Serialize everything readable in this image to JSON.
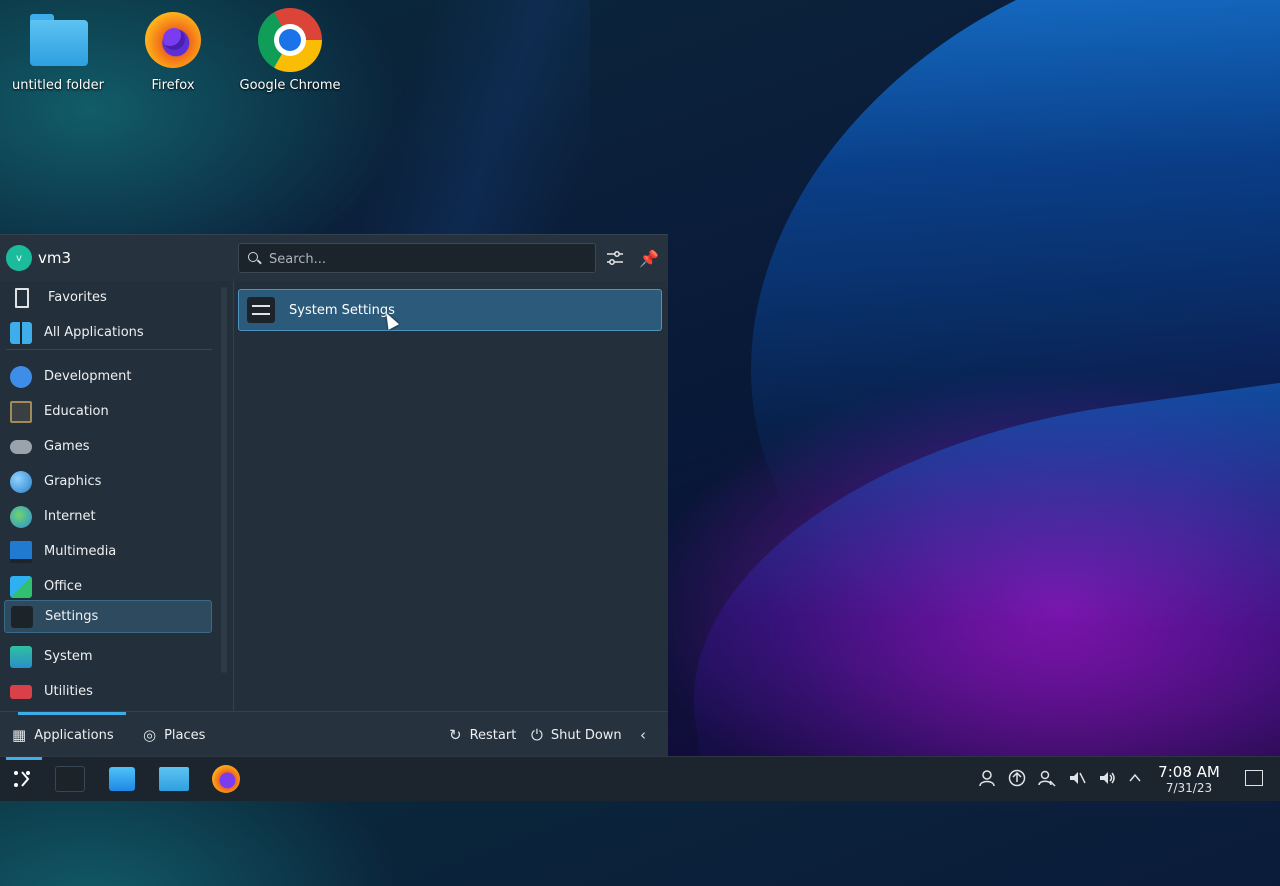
{
  "desktop": {
    "icons": [
      {
        "label": "untitled folder",
        "icon": "folder-icon"
      },
      {
        "label": "Firefox",
        "icon": "firefox-icon"
      },
      {
        "label": "Google Chrome",
        "icon": "chrome-icon"
      }
    ]
  },
  "launcher": {
    "user": {
      "initial": "v",
      "name": "vm3"
    },
    "search": {
      "placeholder": "Search...",
      "value": ""
    },
    "categories": [
      {
        "label": "Favorites",
        "icon": "bookmark-icon"
      },
      {
        "label": "All Applications",
        "icon": "grid-icon"
      },
      {
        "label": "Development",
        "icon": "development-icon"
      },
      {
        "label": "Education",
        "icon": "education-icon"
      },
      {
        "label": "Games",
        "icon": "gamepad-icon"
      },
      {
        "label": "Graphics",
        "icon": "graphics-icon"
      },
      {
        "label": "Internet",
        "icon": "globe-icon"
      },
      {
        "label": "Multimedia",
        "icon": "multimedia-icon"
      },
      {
        "label": "Office",
        "icon": "office-icon"
      },
      {
        "label": "Settings",
        "icon": "settings-icon",
        "selected": true
      },
      {
        "label": "System",
        "icon": "system-icon"
      },
      {
        "label": "Utilities",
        "icon": "utilities-icon"
      }
    ],
    "results": [
      {
        "label": "System Settings",
        "icon": "system-settings-icon"
      }
    ],
    "footer": {
      "applications": "Applications",
      "places": "Places",
      "restart": "Restart",
      "shutdown": "Shut Down"
    }
  },
  "taskbar": {
    "clock": {
      "time": "7:08 AM",
      "date": "7/31/23"
    }
  },
  "colors": {
    "accent": "#3daee9",
    "panel": "#232f3a"
  }
}
